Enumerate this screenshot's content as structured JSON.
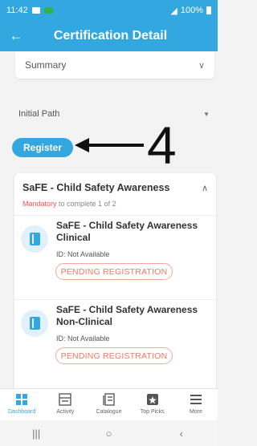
{
  "status_bar": {
    "time": "11:42",
    "battery": "100%"
  },
  "header": {
    "title": "Certification Detail"
  },
  "summary": {
    "label": "Summary"
  },
  "path": {
    "label": "Initial Path"
  },
  "register": {
    "label": "Register"
  },
  "annotation": {
    "text": "4"
  },
  "course": {
    "title": "SaFE - Child Safety Awareness",
    "mandatory_label": "Mandatory",
    "progress_text": " to complete 1 of 2",
    "items": [
      {
        "title": "SaFE - Child Safety Awareness Clinical",
        "id_text": "ID: Not Available",
        "status": "PENDING REGISTRATION"
      },
      {
        "title": "SaFE - Child Safety Awareness Non-Clinical",
        "id_text": "ID: Not Available",
        "status": "PENDING REGISTRATION"
      }
    ]
  },
  "bottom_nav": {
    "items": [
      {
        "label": "Dashboard",
        "icon": "dashboard-icon",
        "active": true
      },
      {
        "label": "Activity",
        "icon": "activity-icon",
        "active": false
      },
      {
        "label": "Catalogue",
        "icon": "catalogue-icon",
        "active": false
      },
      {
        "label": "Top Picks",
        "icon": "top-picks-icon",
        "active": false
      },
      {
        "label": "More",
        "icon": "menu-icon",
        "active": false
      }
    ]
  },
  "colors": {
    "accent": "#33a7e0",
    "mandatory": "#e35b4f",
    "pending": "#e87a66"
  }
}
